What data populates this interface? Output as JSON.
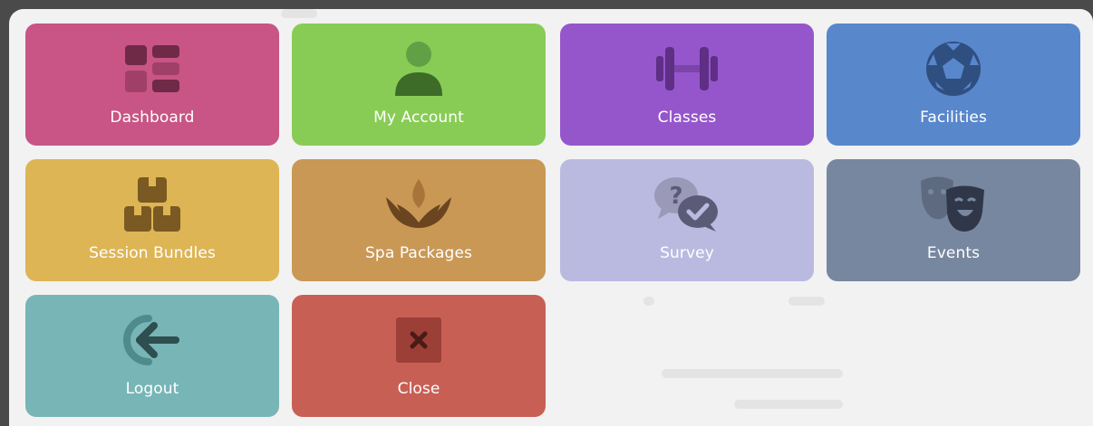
{
  "menu": {
    "tiles": [
      {
        "label": "Dashboard",
        "icon": "dashboard-grid-icon",
        "color": "#c85585"
      },
      {
        "label": "My Account",
        "icon": "user-icon",
        "color": "#88cc55"
      },
      {
        "label": "Classes",
        "icon": "dumbbell-icon",
        "color": "#9556cc"
      },
      {
        "label": "Facilities",
        "icon": "soccer-ball-icon",
        "color": "#5887cc"
      },
      {
        "label": "Session Bundles",
        "icon": "boxes-icon",
        "color": "#ddb555"
      },
      {
        "label": "Spa Packages",
        "icon": "lotus-icon",
        "color": "#c99855"
      },
      {
        "label": "Survey",
        "icon": "chat-question-check-icon",
        "color": "#babae0"
      },
      {
        "label": "Events",
        "icon": "theater-masks-icon",
        "color": "#7887a0"
      },
      {
        "label": "Logout",
        "icon": "logout-arrow-icon",
        "color": "#78b5b7"
      },
      {
        "label": "Close",
        "icon": "close-x-icon",
        "color": "#c85f55"
      }
    ]
  }
}
